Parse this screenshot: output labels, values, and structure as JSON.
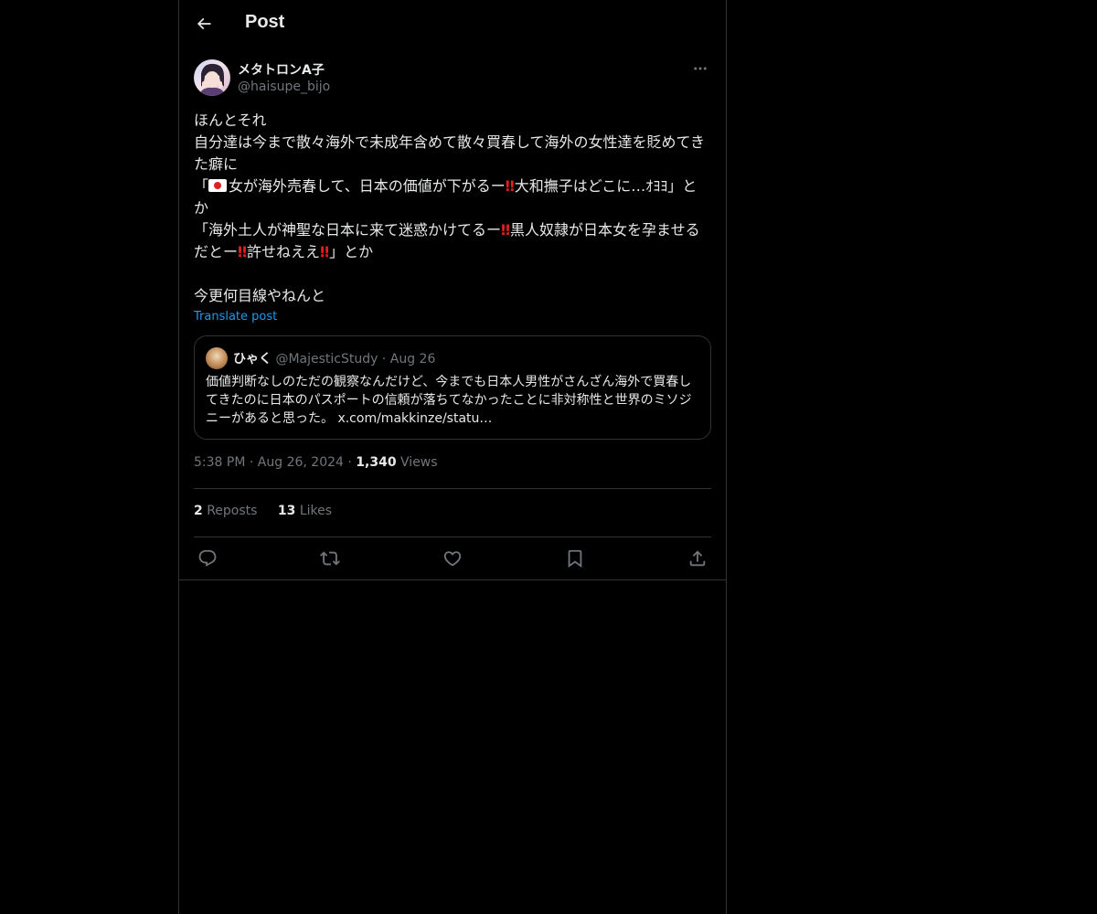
{
  "header": {
    "title": "Post",
    "back_icon": "arrow-left-icon"
  },
  "post": {
    "author": {
      "display_name": "メタトロンA子",
      "handle": "@haisupe_bijo",
      "avatar_icon": "user-avatar"
    },
    "more_icon": "more-horizontal-icon",
    "body": {
      "line1": "ほんとそれ",
      "line2": "自分達は今まで散々海外で未成年含めて散々買春して海外の女性達を貶めてきた癖に",
      "line3_open": "「",
      "line3_text_a": "女が海外売春して、日本の価値が下がるー",
      "line3_text_b": "大和撫子はどこに…ｵﾖﾖ」とか",
      "line4_text_a": "「海外土人が神聖な日本に来て迷惑かけてるー",
      "line4_text_b": "黒人奴隷が日本女を孕ませるだとー",
      "line4_text_c": "許せねええ",
      "line4_text_d": "」とか",
      "line5": "",
      "line6": "今更何目線やねんと",
      "bang_glyph": "‼",
      "flag_emoji": "japan-flag"
    },
    "translate_label": "Translate post",
    "quote": {
      "display_name": "ひゃく",
      "handle": "@MajesticStudy",
      "separator": "·",
      "date": "Aug 26",
      "text": "価値判断なしのただの観察なんだけど、今までも日本人男性がさんざん海外で買春してきたのに日本のパスポートの信頼が落ちてなかったことに非対称性と世界のミソジニーがあると思った。 x.com/makkinze/statu…"
    },
    "timestamp": {
      "time": "5:38 PM",
      "separator": "·",
      "date": "Aug 26, 2024",
      "separator2": "·",
      "views_count": "1,340",
      "views_label": "Views"
    },
    "stats": {
      "reposts_count": "2",
      "reposts_label": "Reposts",
      "likes_count": "13",
      "likes_label": "Likes"
    },
    "actions": [
      "reply-icon",
      "repost-icon",
      "like-icon",
      "bookmark-icon",
      "share-icon"
    ]
  },
  "colors": {
    "background": "#000000",
    "text": "#e7e9ea",
    "muted": "#71767b",
    "border": "#2f3336",
    "link": "#1d9bf0",
    "emoji_red": "#e0201e"
  }
}
